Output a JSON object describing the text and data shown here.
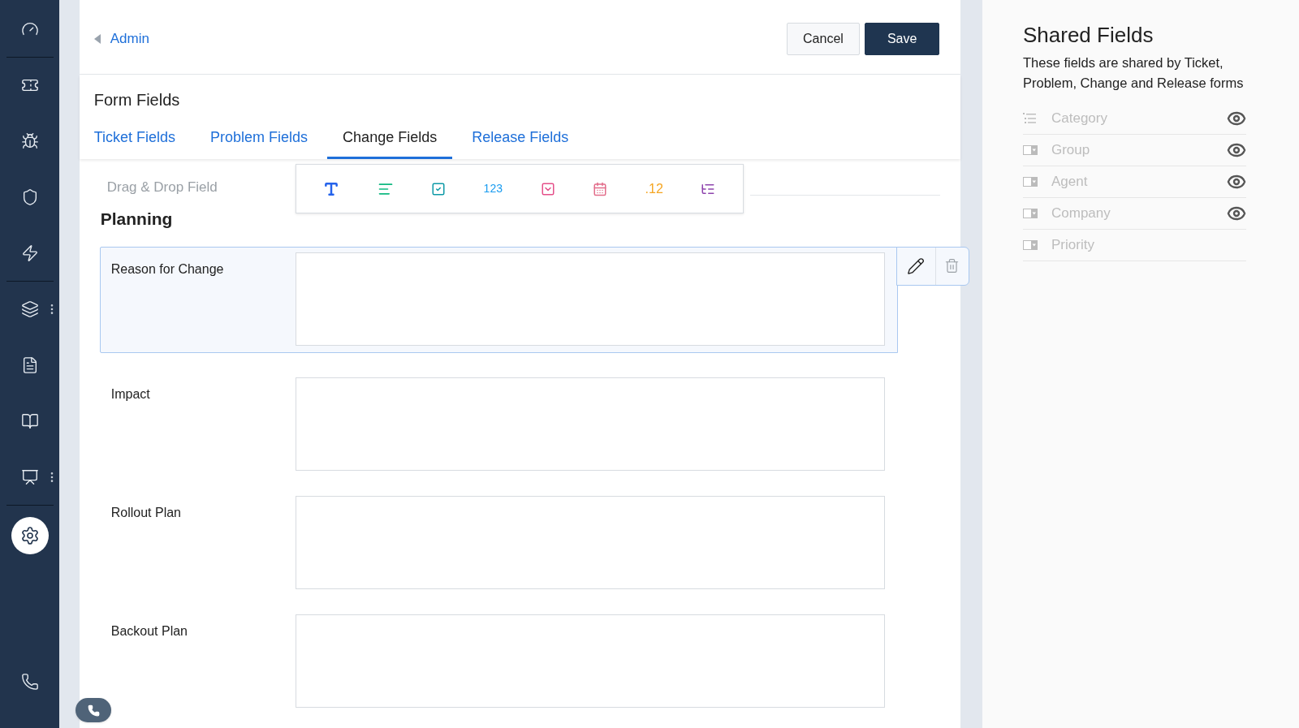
{
  "breadcrumb": {
    "back_label": "Admin"
  },
  "actions": [
    {
      "label": "Cancel",
      "kind": "secondary"
    },
    {
      "label": "Save",
      "kind": "primary"
    }
  ],
  "title": "Form Fields",
  "tabs": [
    {
      "label": "Ticket Fields",
      "selected": false
    },
    {
      "label": "Problem Fields",
      "selected": false
    },
    {
      "label": "Change Fields",
      "selected": true
    },
    {
      "label": "Release Fields",
      "selected": false
    }
  ],
  "palette": {
    "label": "Drag & Drop Field",
    "items": [
      {
        "kind": "text"
      },
      {
        "kind": "paragraph"
      },
      {
        "kind": "checkbox"
      },
      {
        "kind": "number",
        "glyph": "123"
      },
      {
        "kind": "dropdown"
      },
      {
        "kind": "date"
      },
      {
        "kind": "decimal",
        "glyph": ".12"
      },
      {
        "kind": "multiselect"
      }
    ]
  },
  "section": {
    "title": "Planning",
    "fields": [
      {
        "label": "Reason for Change",
        "selected": true
      },
      {
        "label": "Impact",
        "selected": false
      },
      {
        "label": "Rollout Plan",
        "selected": false
      },
      {
        "label": "Backout Plan",
        "selected": false
      }
    ]
  },
  "shared": {
    "title": "Shared Fields",
    "description": "These fields are shared by Ticket, Problem, Change and Release forms",
    "items": [
      {
        "label": "Category",
        "kind": "list",
        "visible": true
      },
      {
        "label": "Group",
        "kind": "dropdown",
        "visible": true
      },
      {
        "label": "Agent",
        "kind": "dropdown",
        "visible": true
      },
      {
        "label": "Company",
        "kind": "dropdown",
        "visible": true
      },
      {
        "label": "Priority",
        "kind": "dropdown",
        "visible": false
      }
    ]
  }
}
